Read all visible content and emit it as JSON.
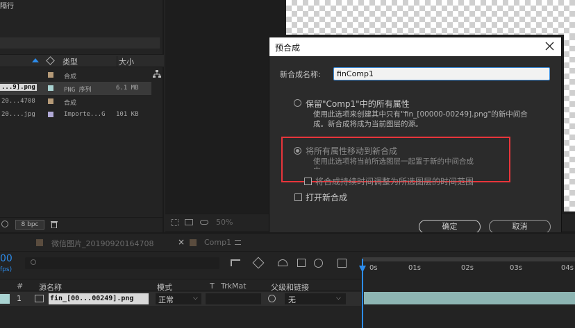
{
  "project": {
    "top_text": "隔行",
    "columns": {
      "type": "类型",
      "size": "大小"
    },
    "items": [
      {
        "name": "",
        "type": "合成",
        "size": "",
        "color": "#b59a78"
      },
      {
        "name": "...9].png",
        "type": "PNG 序列",
        "size": "6.1 MB",
        "color": "#a9d3d2"
      },
      {
        "name": "20...4708",
        "type": "合成",
        "size": "",
        "color": "#b59a78"
      },
      {
        "name": "20....jpg",
        "type": "Importe...G",
        "size": "101 KB",
        "color": "#b0a9d6"
      }
    ],
    "bpc": "8 bpc"
  },
  "viewer": {
    "zoom": "50%"
  },
  "dialog": {
    "title": "预合成",
    "name_label": "新合成名称:",
    "name_value": "finComp1",
    "opt1_title": "保留\"Comp1\"中的所有属性",
    "opt1_desc1": "使用此选项来创建其中只有\"fin_[00000-00249].png\"的新中间合",
    "opt1_desc2": "成。新合成将成为当前图层的源。",
    "opt2_title": "将所有属性移动到新合成",
    "opt2_desc1": "使用此选项将当前所选图层一起置于新的中间合成",
    "opt2_desc2": "中。",
    "check_adjust": "将合成持续时间调整为所选图层的时间范围",
    "check_open": "打开新合成",
    "ok_label": "确定",
    "cancel_label": "取消",
    "highlight_color": "#e8353b"
  },
  "timeline": {
    "tab_inactive": "微信图片_20190920164708",
    "tab_active": "Comp1",
    "time": "00",
    "fps": "fps)",
    "headers": {
      "num": "#",
      "source": "源名称",
      "mode": "模式",
      "t": "T",
      "trkmat": "TrkMat",
      "parent": "父级和链接"
    },
    "layer": {
      "num": "1",
      "name": "fin_[00...00249].png",
      "mode": "正常",
      "parent": "无"
    },
    "ticks": [
      "0s",
      "01s",
      "02s",
      "03s",
      "04s"
    ],
    "accent": "#2d8ceb"
  }
}
